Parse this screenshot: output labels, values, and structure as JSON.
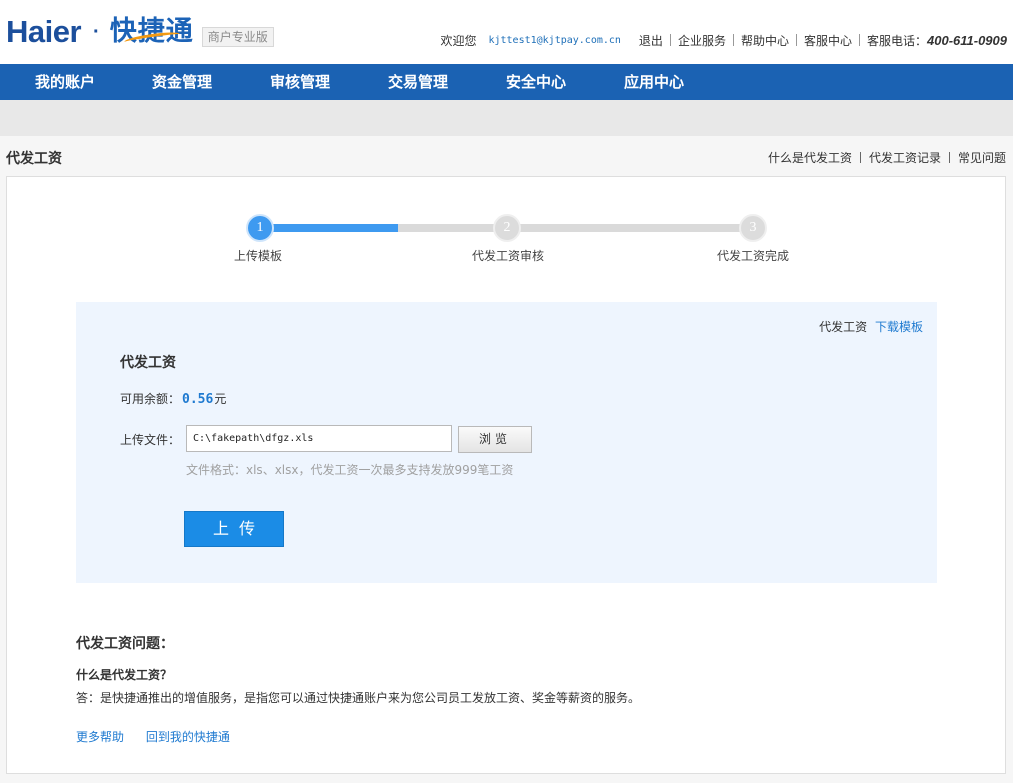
{
  "header": {
    "logo_haier": "Haier",
    "logo_dot": "·",
    "logo_brand": "快捷通",
    "logo_tag": "商户专业版",
    "welcome": "欢迎您",
    "email": "kjttest1@kjtpay.com.cn",
    "links": [
      "退出",
      "企业服务",
      "帮助中心",
      "客服中心"
    ],
    "phone_label": "客服电话：",
    "phone": "400-611-0909"
  },
  "nav": {
    "items": [
      "我的账户",
      "资金管理",
      "审核管理",
      "交易管理",
      "安全中心",
      "应用中心"
    ]
  },
  "titlebar": {
    "title": "代发工资",
    "links": [
      "什么是代发工资",
      "代发工资记录",
      "常见问题"
    ]
  },
  "steps": {
    "current": 1,
    "progress_fraction": 0.28,
    "items": [
      {
        "num": "1",
        "label": "上传模板"
      },
      {
        "num": "2",
        "label": "代发工资审核"
      },
      {
        "num": "3",
        "label": "代发工资完成"
      }
    ]
  },
  "upload": {
    "download_prefix": "代发工资",
    "download_link": "下载模板",
    "title": "代发工资",
    "balance_label": "可用余额：",
    "balance_amount": "0.56",
    "balance_unit": "元",
    "file_label": "上传文件：",
    "file_value": "C:\\fakepath\\dfgz.xls",
    "browse_label": "浏览",
    "hint": "文件格式：xls、xlsx，代发工资一次最多支持发放999笔工资",
    "upload_label": "上传"
  },
  "faq": {
    "title": "代发工资问题：",
    "question": "什么是代发工资？",
    "answer": "答：是快捷通推出的增值服务，是指您可以通过快捷通账户来为您公司员工发放工资、奖金等薪资的服务。",
    "links": [
      "更多帮助",
      "回到我的快捷通"
    ]
  },
  "colors": {
    "nav_bg": "#1b62b3",
    "accent": "#3e9af0",
    "link": "#1f7ad0",
    "upload_button": "#1b8ce6"
  }
}
